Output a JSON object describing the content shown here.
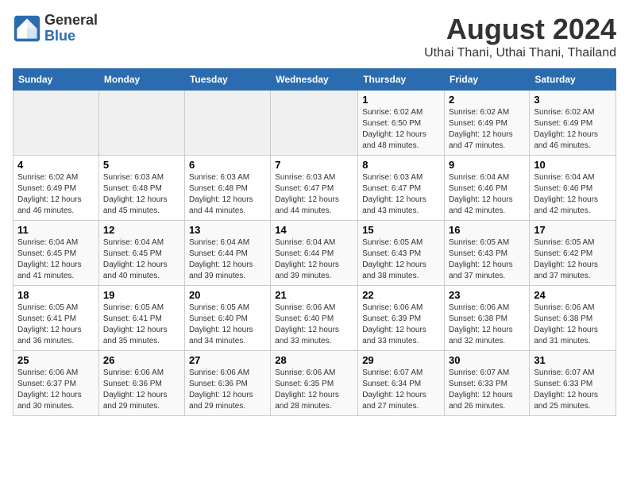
{
  "header": {
    "logo_line1": "General",
    "logo_line2": "Blue",
    "title": "August 2024",
    "subtitle": "Uthai Thani, Uthai Thani, Thailand"
  },
  "weekdays": [
    "Sunday",
    "Monday",
    "Tuesday",
    "Wednesday",
    "Thursday",
    "Friday",
    "Saturday"
  ],
  "weeks": [
    [
      {
        "day": "",
        "info": ""
      },
      {
        "day": "",
        "info": ""
      },
      {
        "day": "",
        "info": ""
      },
      {
        "day": "",
        "info": ""
      },
      {
        "day": "1",
        "info": "Sunrise: 6:02 AM\nSunset: 6:50 PM\nDaylight: 12 hours\nand 48 minutes."
      },
      {
        "day": "2",
        "info": "Sunrise: 6:02 AM\nSunset: 6:49 PM\nDaylight: 12 hours\nand 47 minutes."
      },
      {
        "day": "3",
        "info": "Sunrise: 6:02 AM\nSunset: 6:49 PM\nDaylight: 12 hours\nand 46 minutes."
      }
    ],
    [
      {
        "day": "4",
        "info": "Sunrise: 6:02 AM\nSunset: 6:49 PM\nDaylight: 12 hours\nand 46 minutes."
      },
      {
        "day": "5",
        "info": "Sunrise: 6:03 AM\nSunset: 6:48 PM\nDaylight: 12 hours\nand 45 minutes."
      },
      {
        "day": "6",
        "info": "Sunrise: 6:03 AM\nSunset: 6:48 PM\nDaylight: 12 hours\nand 44 minutes."
      },
      {
        "day": "7",
        "info": "Sunrise: 6:03 AM\nSunset: 6:47 PM\nDaylight: 12 hours\nand 44 minutes."
      },
      {
        "day": "8",
        "info": "Sunrise: 6:03 AM\nSunset: 6:47 PM\nDaylight: 12 hours\nand 43 minutes."
      },
      {
        "day": "9",
        "info": "Sunrise: 6:04 AM\nSunset: 6:46 PM\nDaylight: 12 hours\nand 42 minutes."
      },
      {
        "day": "10",
        "info": "Sunrise: 6:04 AM\nSunset: 6:46 PM\nDaylight: 12 hours\nand 42 minutes."
      }
    ],
    [
      {
        "day": "11",
        "info": "Sunrise: 6:04 AM\nSunset: 6:45 PM\nDaylight: 12 hours\nand 41 minutes."
      },
      {
        "day": "12",
        "info": "Sunrise: 6:04 AM\nSunset: 6:45 PM\nDaylight: 12 hours\nand 40 minutes."
      },
      {
        "day": "13",
        "info": "Sunrise: 6:04 AM\nSunset: 6:44 PM\nDaylight: 12 hours\nand 39 minutes."
      },
      {
        "day": "14",
        "info": "Sunrise: 6:04 AM\nSunset: 6:44 PM\nDaylight: 12 hours\nand 39 minutes."
      },
      {
        "day": "15",
        "info": "Sunrise: 6:05 AM\nSunset: 6:43 PM\nDaylight: 12 hours\nand 38 minutes."
      },
      {
        "day": "16",
        "info": "Sunrise: 6:05 AM\nSunset: 6:43 PM\nDaylight: 12 hours\nand 37 minutes."
      },
      {
        "day": "17",
        "info": "Sunrise: 6:05 AM\nSunset: 6:42 PM\nDaylight: 12 hours\nand 37 minutes."
      }
    ],
    [
      {
        "day": "18",
        "info": "Sunrise: 6:05 AM\nSunset: 6:41 PM\nDaylight: 12 hours\nand 36 minutes."
      },
      {
        "day": "19",
        "info": "Sunrise: 6:05 AM\nSunset: 6:41 PM\nDaylight: 12 hours\nand 35 minutes."
      },
      {
        "day": "20",
        "info": "Sunrise: 6:05 AM\nSunset: 6:40 PM\nDaylight: 12 hours\nand 34 minutes."
      },
      {
        "day": "21",
        "info": "Sunrise: 6:06 AM\nSunset: 6:40 PM\nDaylight: 12 hours\nand 33 minutes."
      },
      {
        "day": "22",
        "info": "Sunrise: 6:06 AM\nSunset: 6:39 PM\nDaylight: 12 hours\nand 33 minutes."
      },
      {
        "day": "23",
        "info": "Sunrise: 6:06 AM\nSunset: 6:38 PM\nDaylight: 12 hours\nand 32 minutes."
      },
      {
        "day": "24",
        "info": "Sunrise: 6:06 AM\nSunset: 6:38 PM\nDaylight: 12 hours\nand 31 minutes."
      }
    ],
    [
      {
        "day": "25",
        "info": "Sunrise: 6:06 AM\nSunset: 6:37 PM\nDaylight: 12 hours\nand 30 minutes."
      },
      {
        "day": "26",
        "info": "Sunrise: 6:06 AM\nSunset: 6:36 PM\nDaylight: 12 hours\nand 29 minutes."
      },
      {
        "day": "27",
        "info": "Sunrise: 6:06 AM\nSunset: 6:36 PM\nDaylight: 12 hours\nand 29 minutes."
      },
      {
        "day": "28",
        "info": "Sunrise: 6:06 AM\nSunset: 6:35 PM\nDaylight: 12 hours\nand 28 minutes."
      },
      {
        "day": "29",
        "info": "Sunrise: 6:07 AM\nSunset: 6:34 PM\nDaylight: 12 hours\nand 27 minutes."
      },
      {
        "day": "30",
        "info": "Sunrise: 6:07 AM\nSunset: 6:33 PM\nDaylight: 12 hours\nand 26 minutes."
      },
      {
        "day": "31",
        "info": "Sunrise: 6:07 AM\nSunset: 6:33 PM\nDaylight: 12 hours\nand 25 minutes."
      }
    ]
  ]
}
